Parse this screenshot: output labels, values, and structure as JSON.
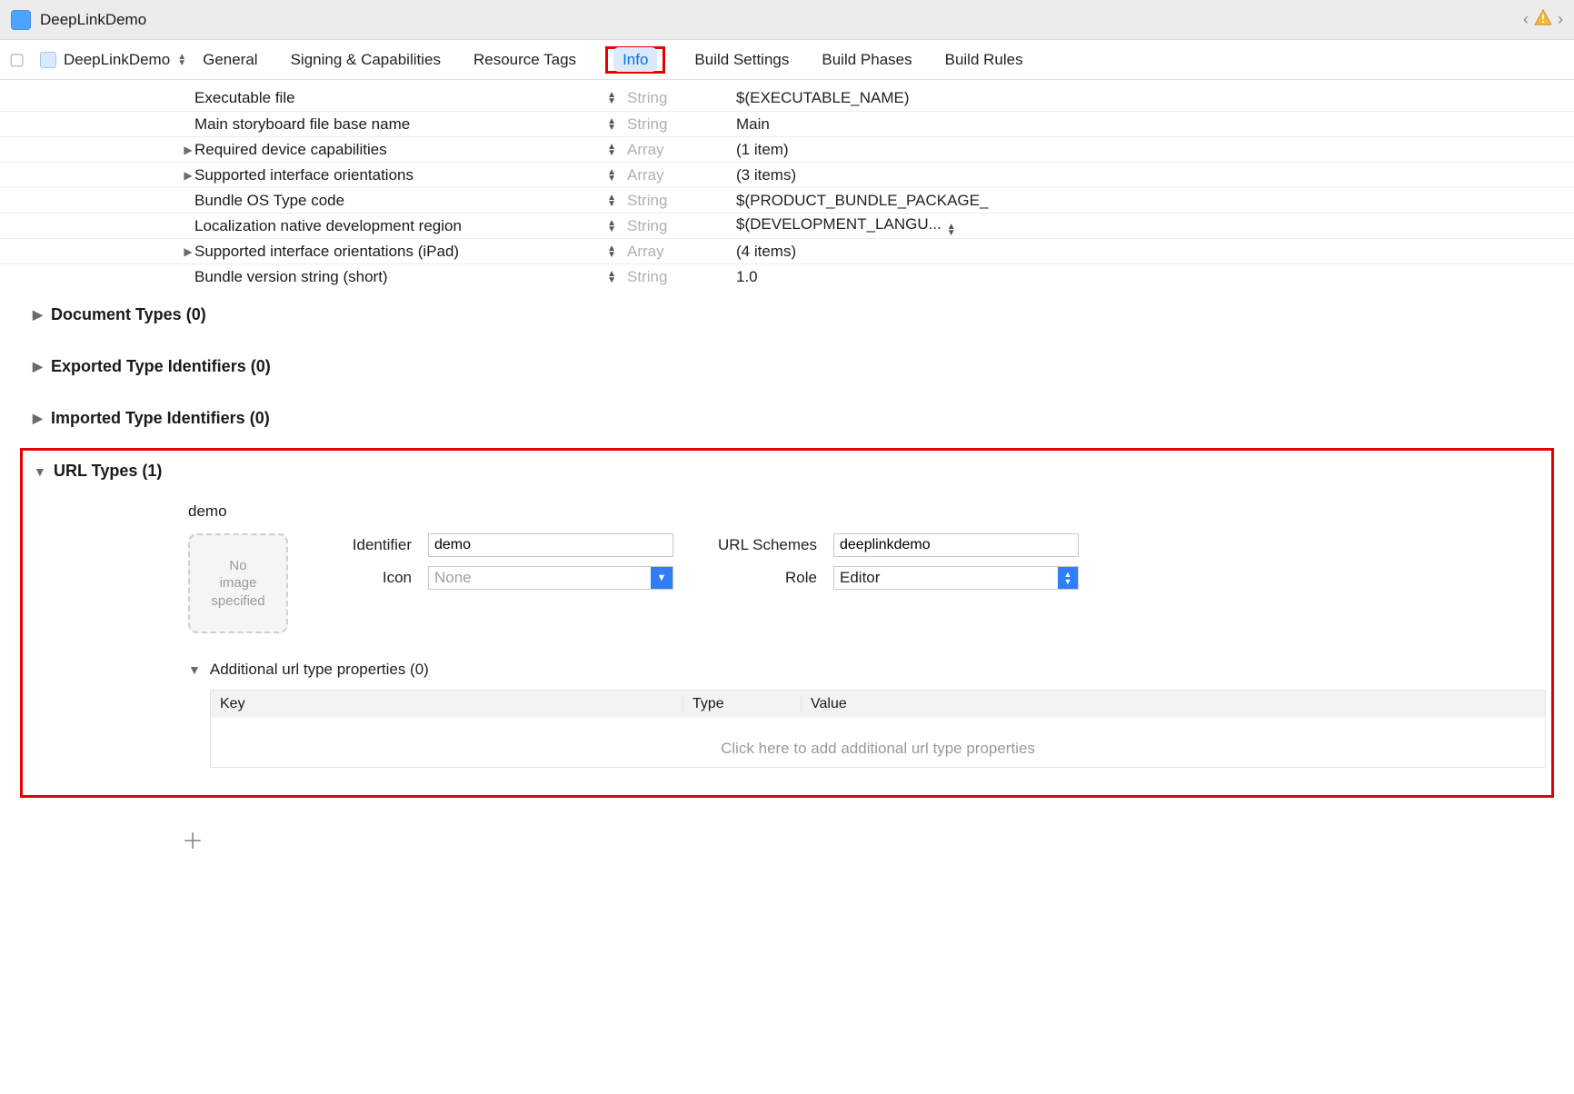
{
  "titlebar": {
    "project_name": "DeepLinkDemo"
  },
  "target_selector": {
    "name": "DeepLinkDemo"
  },
  "tabs": {
    "general": "General",
    "signing": "Signing & Capabilities",
    "resource_tags": "Resource Tags",
    "info": "Info",
    "build_settings": "Build Settings",
    "build_phases": "Build Phases",
    "build_rules": "Build Rules"
  },
  "plist": [
    {
      "expandable": false,
      "key": "Executable file",
      "type": "String",
      "value": "$(EXECUTABLE_NAME)"
    },
    {
      "expandable": false,
      "key": "Main storyboard file base name",
      "type": "String",
      "value": "Main"
    },
    {
      "expandable": true,
      "key": "Required device capabilities",
      "type": "Array",
      "value": "(1 item)"
    },
    {
      "expandable": true,
      "key": "Supported interface orientations",
      "type": "Array",
      "value": "(3 items)"
    },
    {
      "expandable": false,
      "key": "Bundle OS Type code",
      "type": "String",
      "value": "$(PRODUCT_BUNDLE_PACKAGE_"
    },
    {
      "expandable": false,
      "key": "Localization native development region",
      "type": "String",
      "value": "$(DEVELOPMENT_LANGU...",
      "val_stepper": true
    },
    {
      "expandable": true,
      "key": "Supported interface orientations (iPad)",
      "type": "Array",
      "value": "(4 items)"
    },
    {
      "expandable": false,
      "key": "Bundle version string (short)",
      "type": "String",
      "value": "1.0"
    }
  ],
  "sections": {
    "doc_types": "Document Types (0)",
    "exported": "Exported Type Identifiers (0)",
    "imported": "Imported Type Identifiers (0)",
    "url_types": "URL Types (1)"
  },
  "url_type": {
    "name": "demo",
    "image_well": "No\nimage\nspecified",
    "labels": {
      "identifier": "Identifier",
      "url_schemes": "URL Schemes",
      "icon": "Icon",
      "role": "Role"
    },
    "values": {
      "identifier": "demo",
      "url_schemes": "deeplinkdemo",
      "icon": "None",
      "role": "Editor"
    },
    "additional_header": "Additional url type properties (0)",
    "table_headers": {
      "key": "Key",
      "type": "Type",
      "value": "Value"
    },
    "table_placeholder": "Click here to add additional url type properties"
  }
}
